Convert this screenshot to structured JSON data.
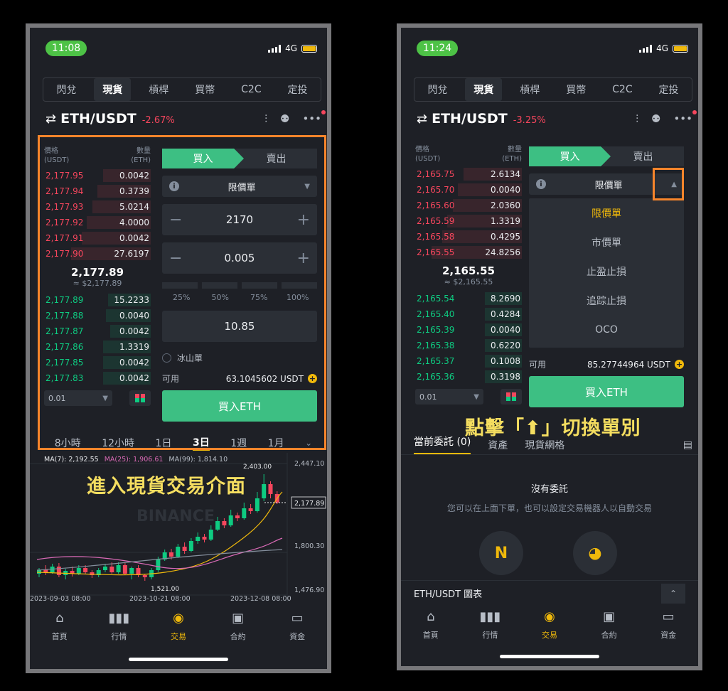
{
  "left": {
    "status": {
      "time": "11:08",
      "network": "4G"
    },
    "tabs": [
      "閃兌",
      "現貨",
      "槓桿",
      "買幣",
      "C2C",
      "定投"
    ],
    "pair": {
      "name": "ETH/USDT",
      "change": "-2.67%"
    },
    "orderbook": {
      "price_header": "價格\n(USDT)",
      "qty_header": "數量\n(ETH)",
      "asks": [
        {
          "price": "2,177.95",
          "qty": "0.0042",
          "depth": 0.45
        },
        {
          "price": "2,177.94",
          "qty": "0.3739",
          "depth": 0.5
        },
        {
          "price": "2,177.93",
          "qty": "5.0214",
          "depth": 0.55
        },
        {
          "price": "2,177.92",
          "qty": "4.0000",
          "depth": 0.6
        },
        {
          "price": "2,177.91",
          "qty": "0.0042",
          "depth": 0.65
        },
        {
          "price": "2,177.90",
          "qty": "27.6197",
          "depth": 0.75
        }
      ],
      "mid_price": "2,177.89",
      "mid_sub": "≈ $2,177.89",
      "bids": [
        {
          "price": "2,177.89",
          "qty": "15.2233",
          "depth": 0.4
        },
        {
          "price": "2,177.88",
          "qty": "0.0040",
          "depth": 0.42
        },
        {
          "price": "2,177.87",
          "qty": "0.0042",
          "depth": 0.38
        },
        {
          "price": "2,177.86",
          "qty": "1.3319",
          "depth": 0.45
        },
        {
          "price": "2,177.85",
          "qty": "0.0042",
          "depth": 0.45
        },
        {
          "price": "2,177.83",
          "qty": "0.0042",
          "depth": 0.45
        }
      ],
      "precision": "0.01"
    },
    "form": {
      "buy": "買入",
      "sell": "賣出",
      "order_type": "限價單",
      "price": "2170",
      "amount": "0.005",
      "percents": [
        "25%",
        "50%",
        "75%",
        "100%"
      ],
      "total": "10.85",
      "iceberg": "冰山單",
      "available_label": "可用",
      "available_value": "63.1045602 USDT",
      "buy_button": "買入ETH"
    },
    "timeframes": [
      "8小時",
      "12小時",
      "1日",
      "3日",
      "1週",
      "1月"
    ],
    "active_timeframe": "3日",
    "ma": {
      "ma7": "MA(7): 2,192.55",
      "ma25": "MA(25): 1,906.61",
      "ma99": "MA(99): 1,814.10"
    },
    "chart_data": {
      "type": "candlestick",
      "y_ticks": [
        "2,447.10",
        "1,800.30",
        "1,476.90"
      ],
      "x_ticks": [
        "2023-09-03 08:00",
        "2023-10-21 08:00",
        "2023-12-08 08:00"
      ],
      "last_price": "2,177.89",
      "high_label": "2,403.00",
      "low_label": "1,521.00",
      "watermark": "BINANCE"
    },
    "overlay": "進入現貨交易介面",
    "nav": [
      "首頁",
      "行情",
      "交易",
      "合約",
      "資金"
    ],
    "active_nav": "交易"
  },
  "right": {
    "status": {
      "time": "11:24",
      "network": "4G"
    },
    "tabs": [
      "閃兌",
      "現貨",
      "槓桿",
      "買幣",
      "C2C",
      "定投"
    ],
    "pair": {
      "name": "ETH/USDT",
      "change": "-3.25%"
    },
    "orderbook": {
      "price_header": "價格\n(USDT)",
      "qty_header": "數量\n(ETH)",
      "asks": [
        {
          "price": "2,165.75",
          "qty": "2.6134",
          "depth": 0.55
        },
        {
          "price": "2,165.70",
          "qty": "0.0040",
          "depth": 0.6
        },
        {
          "price": "2,165.60",
          "qty": "2.0360",
          "depth": 0.65
        },
        {
          "price": "2,165.59",
          "qty": "1.3319",
          "depth": 0.7
        },
        {
          "price": "2,165.58",
          "qty": "0.4295",
          "depth": 0.75
        },
        {
          "price": "2,165.55",
          "qty": "24.8256",
          "depth": 0.85
        }
      ],
      "mid_price": "2,165.55",
      "mid_sub": "≈ $2,165.55",
      "bids": [
        {
          "price": "2,165.54",
          "qty": "8.2690",
          "depth": 0.35
        },
        {
          "price": "2,165.40",
          "qty": "0.4284",
          "depth": 0.35
        },
        {
          "price": "2,165.39",
          "qty": "0.0040",
          "depth": 0.35
        },
        {
          "price": "2,165.38",
          "qty": "0.6220",
          "depth": 0.35
        },
        {
          "price": "2,165.37",
          "qty": "0.1008",
          "depth": 0.35
        },
        {
          "price": "2,165.36",
          "qty": "0.3198",
          "depth": 0.35
        }
      ],
      "precision": "0.01"
    },
    "form": {
      "buy": "買入",
      "sell": "賣出",
      "order_type": "限價單",
      "available_label": "可用",
      "available_value": "85.27744964 USDT",
      "buy_button": "買入ETH"
    },
    "dropdown": [
      "限價單",
      "市價單",
      "止盈止損",
      "追踪止損",
      "OCO"
    ],
    "overlay": "點擊「⬆」切換單別",
    "order_tabs": [
      "當前委託 (0)",
      "資產",
      "現貨網格"
    ],
    "empty_title": "沒有委託",
    "empty_sub": "您可以在上面下單，也可以設定交易機器人以自動交易",
    "chart_bar": "ETH/USDT 圖表",
    "nav": [
      "首頁",
      "行情",
      "交易",
      "合約",
      "資金"
    ],
    "active_nav": "交易"
  },
  "colors": {
    "green": "#3dbf83",
    "red": "#f6465d",
    "accent": "#f0b90b",
    "highlight": "#f7852b",
    "overlay_text": "#f5de60"
  },
  "icons": [
    "swap-icon",
    "candlestick-icon",
    "robot-icon",
    "more-icon",
    "info-icon",
    "plus-circle-icon",
    "home-icon",
    "markets-icon",
    "trade-icon",
    "futures-icon",
    "wallet-icon"
  ]
}
